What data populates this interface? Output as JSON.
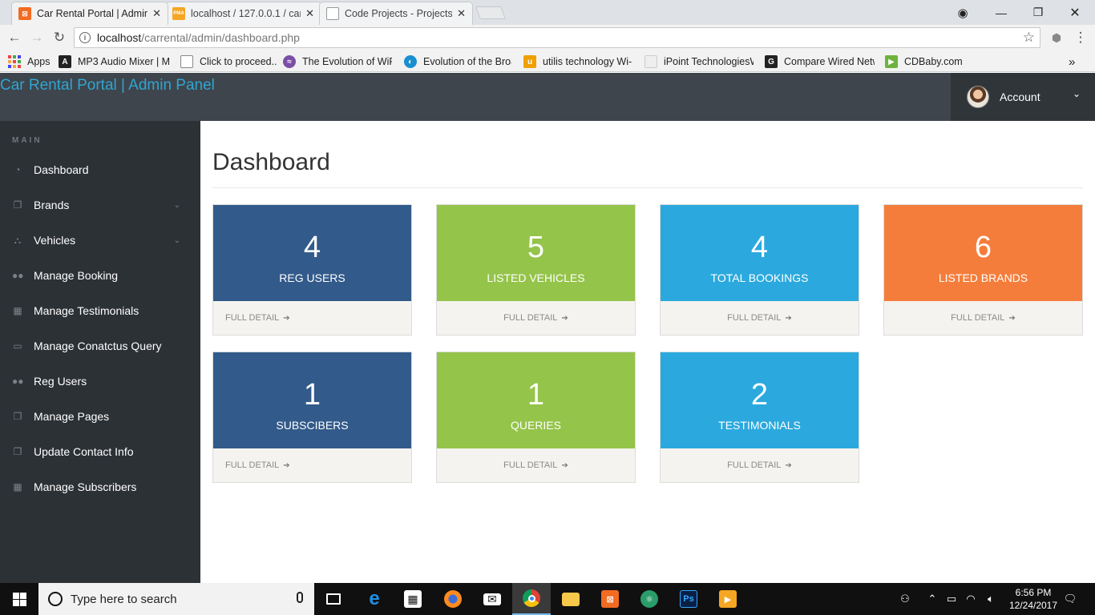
{
  "browser": {
    "tabs": [
      {
        "title": "Car Rental Portal | Admin",
        "favicon": "xampp-icon",
        "fav_text": "",
        "color": "#f26b22"
      },
      {
        "title": "localhost / 127.0.0.1 / car",
        "favicon": "phpmyadmin-icon",
        "fav_text": "PMA",
        "color": "#f5a623"
      },
      {
        "title": "Code Projects - Projects,",
        "favicon": "document-icon",
        "fav_text": "",
        "color": "#ffffff"
      }
    ],
    "url_host": "localhost",
    "url_path": "/carrental/admin/dashboard.php",
    "bookmarks": [
      {
        "label": "Apps",
        "icon": "apps-grid-icon"
      },
      {
        "label": "MP3 Audio Mixer | M",
        "icon": "mixer-icon"
      },
      {
        "label": "Click to proceed...",
        "icon": "document-icon"
      },
      {
        "label": "The Evolution of WiFi",
        "icon": "wifi-icon"
      },
      {
        "label": "Evolution of the Broa",
        "icon": "globe-icon"
      },
      {
        "label": "utilis technology Wi-F",
        "icon": "utilis-icon"
      },
      {
        "label": "iPoint TechnologiesW",
        "icon": "ipoint-icon"
      },
      {
        "label": "Compare Wired Netw",
        "icon": "g-icon"
      },
      {
        "label": "CDBaby.com",
        "icon": "cdbaby-icon"
      }
    ],
    "more": "»"
  },
  "header": {
    "brand": "Car Rental Portal | Admin Panel",
    "account_label": "Account"
  },
  "sidebar": {
    "heading": "MAIN",
    "items": [
      {
        "label": "Dashboard",
        "icon": "dashboard-icon",
        "has_submenu": false
      },
      {
        "label": "Brands",
        "icon": "files-icon",
        "has_submenu": true
      },
      {
        "label": "Vehicles",
        "icon": "sitemap-icon",
        "has_submenu": true
      },
      {
        "label": "Manage Booking",
        "icon": "users-icon",
        "has_submenu": false
      },
      {
        "label": "Manage Testimonials",
        "icon": "table-icon",
        "has_submenu": false
      },
      {
        "label": "Manage Conatctus Query",
        "icon": "desktop-icon",
        "has_submenu": false
      },
      {
        "label": "Reg Users",
        "icon": "users-icon",
        "has_submenu": false
      },
      {
        "label": "Manage Pages",
        "icon": "files-icon",
        "has_submenu": false
      },
      {
        "label": "Update Contact Info",
        "icon": "files-icon",
        "has_submenu": false
      },
      {
        "label": "Manage Subscribers",
        "icon": "table-icon",
        "has_submenu": false
      }
    ]
  },
  "main": {
    "title": "Dashboard",
    "cards": [
      {
        "value": "4",
        "label": "REG USERS",
        "detail": "FULL DETAIL",
        "color": "#325a8a"
      },
      {
        "value": "5",
        "label": "LISTED VEHICLES",
        "detail": "FULL DETAIL",
        "color": "#94c449"
      },
      {
        "value": "4",
        "label": "TOTAL BOOKINGS",
        "detail": "FULL DETAIL",
        "color": "#2ba9de"
      },
      {
        "value": "6",
        "label": "LISTED BRANDS",
        "detail": "FULL DETAIL",
        "color": "#f57d3b"
      },
      {
        "value": "1",
        "label": "SUBSCIBERS",
        "detail": "FULL DETAIL",
        "color": "#325a8a"
      },
      {
        "value": "1",
        "label": "QUERIES",
        "detail": "FULL DETAIL",
        "color": "#94c449"
      },
      {
        "value": "2",
        "label": "TESTIMONIALS",
        "detail": "FULL DETAIL",
        "color": "#2ba9de"
      }
    ]
  },
  "taskbar": {
    "search_placeholder": "Type here to search",
    "apps": [
      "task-view-icon",
      "edge-icon",
      "store-icon",
      "firefox-icon",
      "mail-icon",
      "chrome-icon",
      "file-explorer-icon",
      "xampp-icon",
      "atom-icon",
      "photoshop-icon",
      "media-player-icon"
    ],
    "time": "6:56 PM",
    "date": "12/24/2017"
  }
}
